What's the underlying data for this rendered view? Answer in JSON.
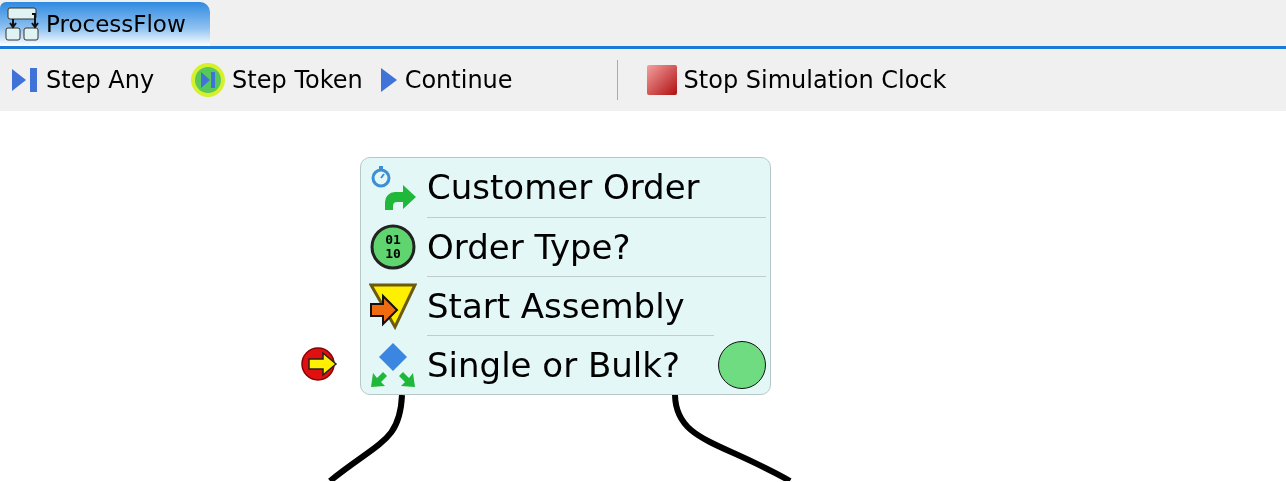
{
  "tab": {
    "title": "ProcessFlow",
    "selected": true
  },
  "toolbar": [
    {
      "kind": "step-any",
      "label": "Step Any"
    },
    {
      "kind": "step-token",
      "label": "Step Token"
    },
    {
      "kind": "continue",
      "label": "Continue"
    },
    {
      "kind": "separator"
    },
    {
      "kind": "stop",
      "label": "Stop Simulation Clock"
    }
  ],
  "blocks": [
    {
      "kind": "source",
      "label": "Customer Order",
      "current": false
    },
    {
      "kind": "decide-binary",
      "label": "Order Type?",
      "icon_text": [
        "01",
        "10"
      ],
      "current": false
    },
    {
      "kind": "start-assembly",
      "label": "Start Assembly",
      "current": false
    },
    {
      "kind": "decide",
      "label": "Single or Bulk?",
      "current": true,
      "token": {
        "color": "#6fdc82"
      }
    }
  ]
}
